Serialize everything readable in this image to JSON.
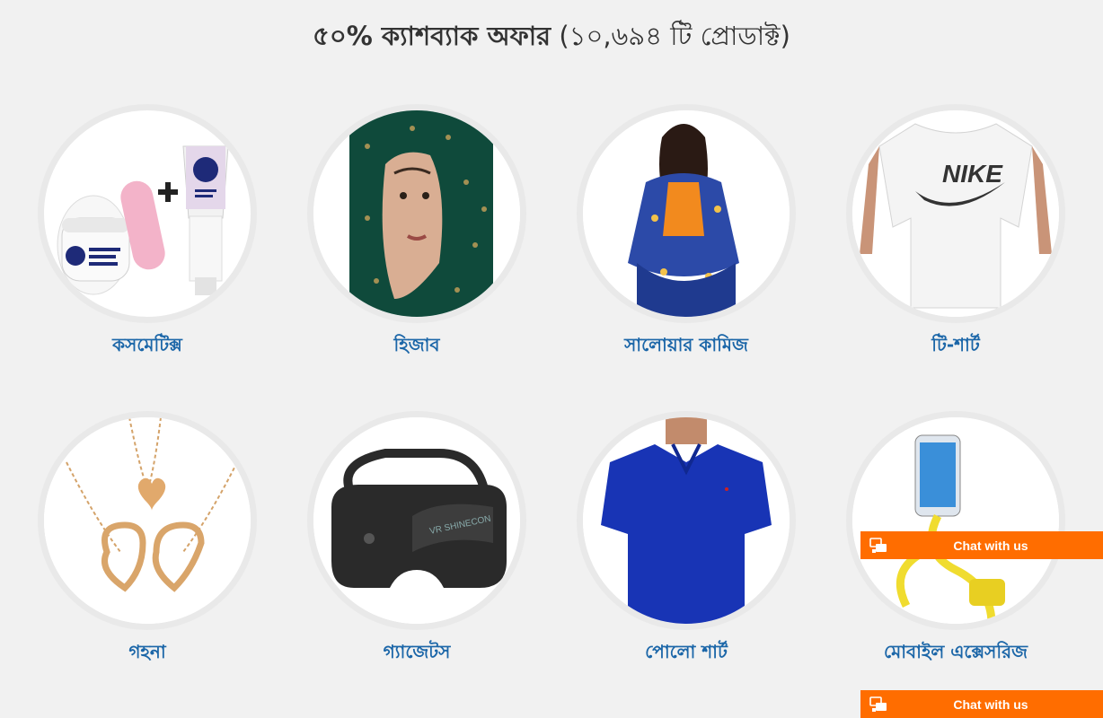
{
  "heading": {
    "offer": "৫০% ক্যাশব্যাক অফার",
    "count": "(১০,৬৯৪ টি প্রোডাক্ট)"
  },
  "categories": [
    {
      "label": "কসমেটিক্স",
      "icon": "cosmetics-image"
    },
    {
      "label": "হিজাব",
      "icon": "hijab-image"
    },
    {
      "label": "সালোয়ার কামিজ",
      "icon": "salwar-kameez-image"
    },
    {
      "label": "টি-শার্ট",
      "icon": "tshirt-image"
    },
    {
      "label": "গহনা",
      "icon": "jewelry-image"
    },
    {
      "label": "গ্যাজেটস",
      "icon": "vr-headset-image"
    },
    {
      "label": "পোলো শার্ট",
      "icon": "polo-shirt-image"
    },
    {
      "label": "মোবাইল এক্সেসরিজ",
      "icon": "phone-holder-image"
    }
  ],
  "chat": {
    "label": "Chat with us",
    "label_bottom": "Chat with us",
    "color": "#ff6d00"
  },
  "colors": {
    "label": "#1b66a8",
    "title": "#333333",
    "background": "#f1f1f1"
  }
}
